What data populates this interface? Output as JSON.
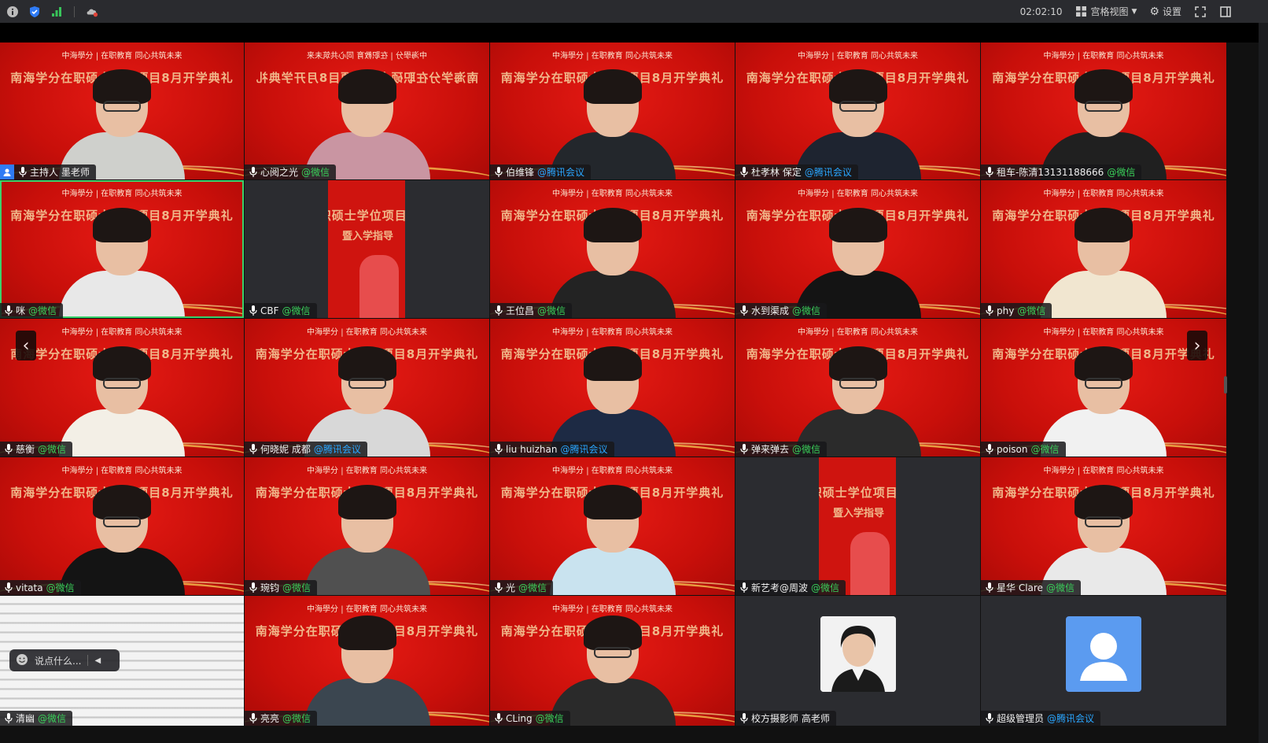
{
  "toolbar": {
    "time": "02:02:10",
    "view_label": "宫格视图",
    "settings_label": "设置"
  },
  "banner": {
    "logo_text": "中海學分 | 在职教育   同心共筑未来",
    "title": "南海学分在职硕士学位项目8月开学典礼",
    "subtitle": "暨入学指导"
  },
  "chat": {
    "placeholder": "说点什么..."
  },
  "participants": [
    {
      "name": "主持人 墨老师",
      "source": "",
      "host": true
    },
    {
      "name": "心阅之光",
      "source": "@微信"
    },
    {
      "name": "伯维锋",
      "source": "@腾讯会议"
    },
    {
      "name": "杜孝林 保定",
      "source": "@腾讯会议"
    },
    {
      "name": "租车-陈清13131188666",
      "source": "@微信"
    },
    {
      "name": "咪",
      "source": "@微信"
    },
    {
      "name": "CBF",
      "source": "@微信"
    },
    {
      "name": "王位昌",
      "source": "@微信"
    },
    {
      "name": "水到渠成",
      "source": "@微信"
    },
    {
      "name": "phy",
      "source": "@微信"
    },
    {
      "name": "慈衡",
      "source": "@微信"
    },
    {
      "name": "何晓妮 成都",
      "source": "@腾讯会议"
    },
    {
      "name": "liu huizhan",
      "source": "@腾讯会议"
    },
    {
      "name": "弹来弹去",
      "source": "@微信"
    },
    {
      "name": "poison",
      "source": "@微信"
    },
    {
      "name": "vitata",
      "source": "@微信"
    },
    {
      "name": "琬钧",
      "source": "@微信"
    },
    {
      "name": "光",
      "source": "@微信"
    },
    {
      "name": "新艺考@周波",
      "source": "@微信"
    },
    {
      "name": "星华 Clare",
      "source": "@微信"
    },
    {
      "name": "清幽",
      "source": "@微信"
    },
    {
      "name": "亮亮",
      "source": "@微信"
    },
    {
      "name": "CLing",
      "source": "@微信"
    },
    {
      "name": "校方摄影师 高老师",
      "source": ""
    },
    {
      "name": "超级管理员",
      "source": "@腾讯会议"
    }
  ],
  "colors": {
    "banner_red": "#d8140f",
    "wechat_green": "#3ad15a",
    "tencent_blue": "#2aa6ff",
    "active_border": "#3bd26b"
  }
}
